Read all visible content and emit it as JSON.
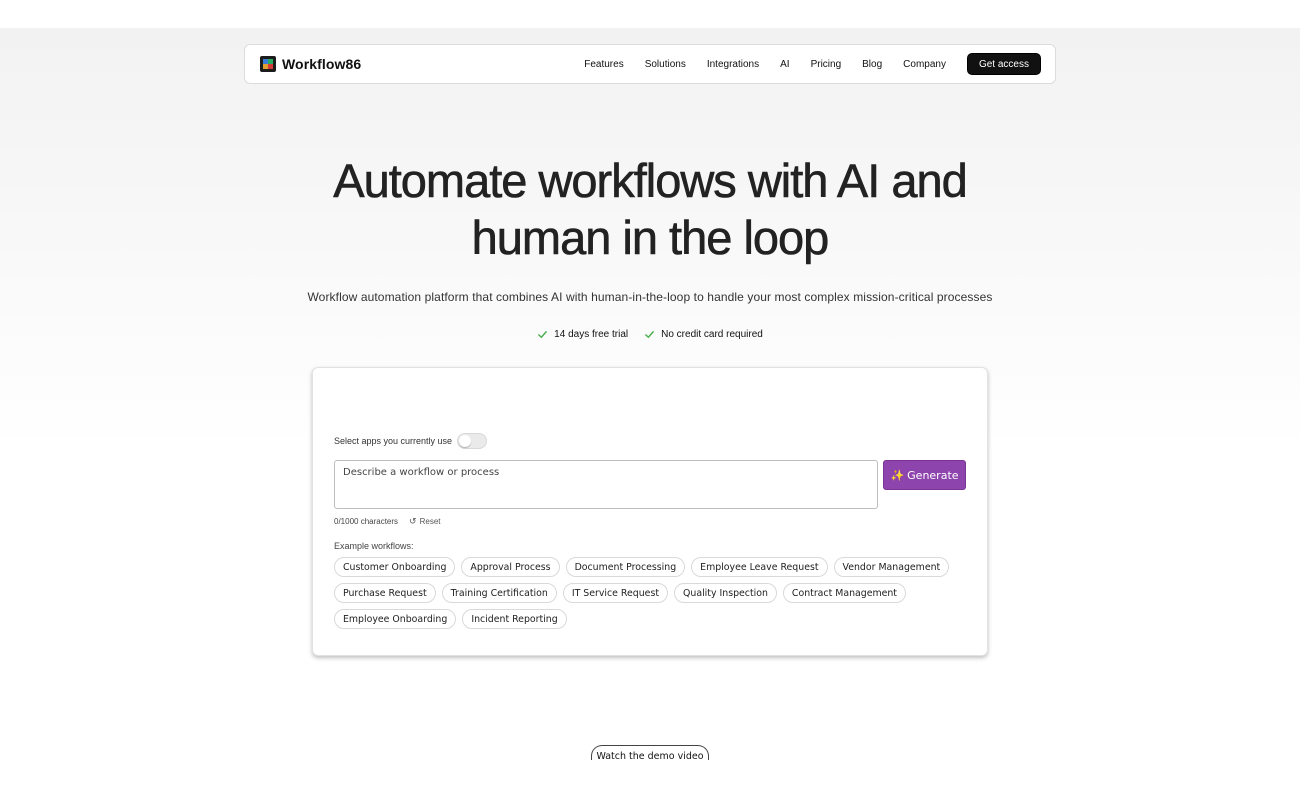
{
  "brand": {
    "name": "Workflow86",
    "logo_icon": "workflow86-logo-icon"
  },
  "nav": {
    "links": [
      "Features",
      "Solutions",
      "Integrations",
      "AI",
      "Pricing",
      "Blog",
      "Company"
    ],
    "cta_label": "Get access"
  },
  "hero": {
    "headline_line1": "Automate workflows with AI and",
    "headline_line2": "human in the loop",
    "subtitle": "Workflow automation platform that combines AI with human-in-the-loop to handle your most complex mission-critical processes",
    "perks": [
      "14 days free trial",
      "No credit card required"
    ]
  },
  "composer": {
    "apps_toggle_label": "Select apps you currently use",
    "apps_toggle_on": false,
    "textarea_placeholder": "Describe a workflow or process",
    "textarea_value": "",
    "generate_label": "Generate",
    "generate_icon": "sparkles-icon",
    "char_count": "0/1000 characters",
    "reset_label": "Reset",
    "examples_label": "Example workflows:",
    "examples": [
      [
        "Customer Onboarding",
        "Approval Process",
        "Document Processing",
        "Employee Leave Request",
        "Vendor Management"
      ],
      [
        "Purchase Request",
        "Training Certification",
        "IT Service Request",
        "Quality Inspection",
        "Contract Management"
      ],
      [
        "Employee Onboarding",
        "Incident Reporting"
      ]
    ]
  },
  "demo_button_label": "Watch the demo video",
  "colors": {
    "accent_purple": "#8e44ad",
    "cta_black": "#111111",
    "check_green": "#4caf50"
  }
}
